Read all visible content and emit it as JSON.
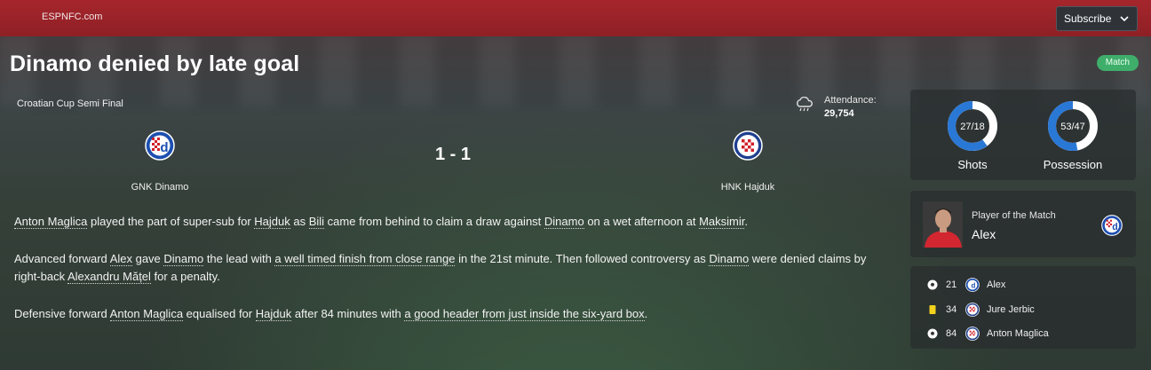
{
  "header": {
    "site_name": "ESPNFC.com",
    "subscribe_label": "Subscribe"
  },
  "article": {
    "title": "Dinamo denied by late goal",
    "badge": "Match",
    "competition": "Croatian Cup Semi Final",
    "weather_icon": "rain-cloud-icon",
    "attendance_label": "Attendance:",
    "attendance_value": "29,754",
    "score": "1 - 1",
    "home_team": "GNK Dinamo",
    "away_team": "HNK Hajduk",
    "p1": {
      "a": "Anton Maglica",
      "b": " played the part of super-sub for ",
      "c": "Hajduk",
      "d": " as ",
      "e": "Bili",
      "f": " came from behind to claim a draw against ",
      "g": "Dinamo",
      "h": " on a wet afternoon at ",
      "i": "Maksimir",
      "j": "."
    },
    "p2": {
      "a": "Advanced forward ",
      "b": "Alex",
      "c": " gave ",
      "d": "Dinamo",
      "e": " the lead with ",
      "f": "a well timed finish from close range",
      "g": " in the 21st minute. Then followed controversy as ",
      "h": "Dinamo",
      "i": " were denied claims by right-back ",
      "j": "Alexandru Mățel",
      "k": " for a penalty."
    },
    "p3": {
      "a": "Defensive forward ",
      "b": "Anton Maglica",
      "c": " equalised for ",
      "d": "Hajduk",
      "e": " after 84 minutes with ",
      "f": "a good header from just inside the six-yard box",
      "g": "."
    }
  },
  "stats": {
    "shots": {
      "label": "Shots",
      "text": "27/18",
      "home": 27,
      "away": 18
    },
    "possession": {
      "label": "Possession",
      "text": "53/47",
      "home": 53,
      "away": 47
    }
  },
  "player_of_match": {
    "label": "Player of the Match",
    "name": "Alex"
  },
  "events": [
    {
      "icon": "football-icon",
      "minute": "21",
      "team": "dinamo",
      "player": "Alex"
    },
    {
      "icon": "yellow-card-icon",
      "minute": "34",
      "team": "hajduk",
      "player": "Jure Jerbic"
    },
    {
      "icon": "football-icon",
      "minute": "84",
      "team": "hajduk",
      "player": "Anton Maglica"
    }
  ],
  "colors": {
    "topbar": "#a5262c",
    "donut_home": "#2a78d6",
    "donut_away": "#ffffff",
    "badge": "#3fae6b",
    "dinamo_blue": "#1d4fb0",
    "hajduk_red": "#d0202a"
  }
}
